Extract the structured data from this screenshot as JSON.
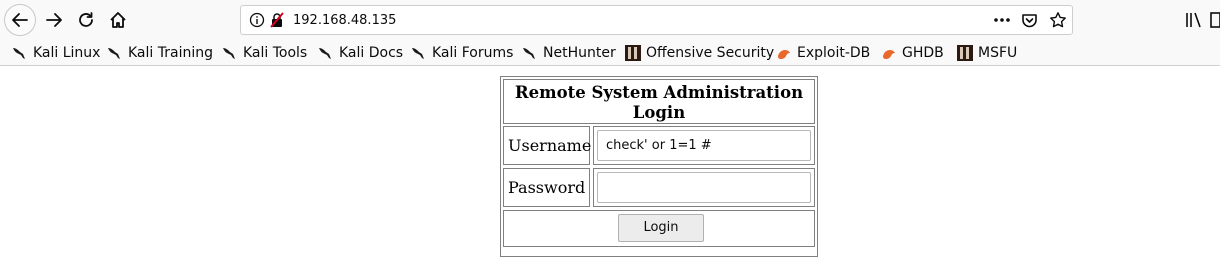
{
  "browser": {
    "url": "192.168.48.135",
    "bookmarks": [
      {
        "label": "Kali Linux",
        "icon": "kali-dragon-icon"
      },
      {
        "label": "Kali Training",
        "icon": "kali-dragon-icon"
      },
      {
        "label": "Kali Tools",
        "icon": "kali-dragon-icon"
      },
      {
        "label": "Kali Docs",
        "icon": "kali-dragon-icon"
      },
      {
        "label": "Kali Forums",
        "icon": "kali-dragon-icon"
      },
      {
        "label": "NetHunter",
        "icon": "kali-dragon-icon"
      },
      {
        "label": "Offensive Security",
        "icon": "offsec-icon"
      },
      {
        "label": "Exploit-DB",
        "icon": "exploitdb-icon"
      },
      {
        "label": "GHDB",
        "icon": "exploitdb-icon"
      },
      {
        "label": "MSFU",
        "icon": "offsec-icon"
      }
    ]
  },
  "login_form": {
    "title_line1": "Remote System Administration",
    "title_line2": "Login",
    "username_label": "Username",
    "username_value": "check' or 1=1 #",
    "password_label": "Password",
    "password_value": "",
    "submit_label": "Login"
  }
}
